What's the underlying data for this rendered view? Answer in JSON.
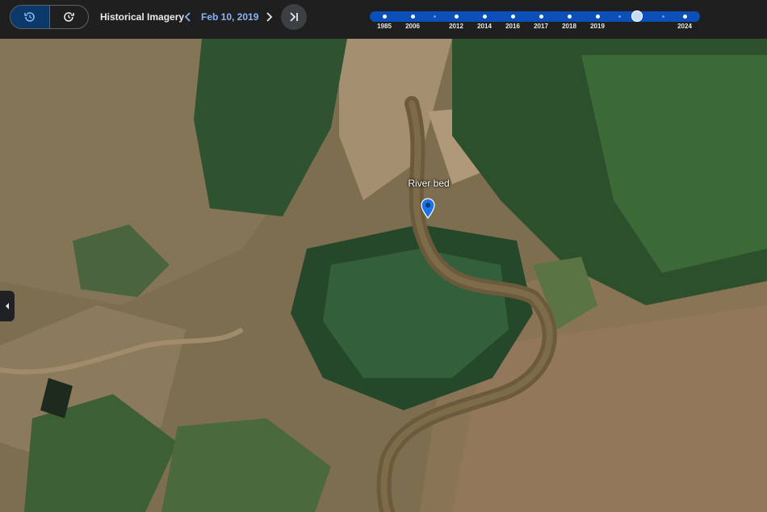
{
  "header": {
    "title": "Historical Imagery",
    "date": "Feb 10, 2019"
  },
  "timeline": {
    "years": [
      "1985",
      "2006",
      "2012",
      "2014",
      "2016",
      "2017",
      "2018",
      "2019",
      "2024"
    ],
    "selected_fraction": 0.81
  },
  "map": {
    "pin_label": "River bed"
  },
  "colors": {
    "accent": "#8ab4f8",
    "timeline_track": "#0b4fb8",
    "toolbar_bg": "#1f1f1f",
    "pin": "#1a73e8"
  },
  "icons": [
    "history-icon",
    "time-travel-icon",
    "chevron-left-icon",
    "chevron-right-icon",
    "skip-to-latest-icon",
    "location-pin-icon",
    "collapse-panel-icon"
  ]
}
